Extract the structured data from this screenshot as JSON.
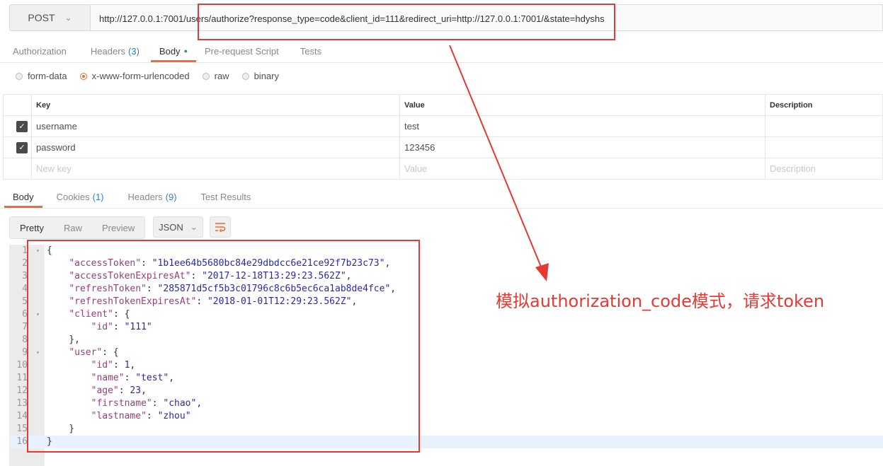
{
  "request": {
    "method": "POST",
    "url": "http://127.0.0.1:7001/users/authorize?response_type=code&client_id=111&redirect_uri=http://127.0.0.1:7001/&state=hdyshs"
  },
  "request_tabs": [
    {
      "label": "Authorization",
      "count": ""
    },
    {
      "label": "Headers",
      "count": "(3)"
    },
    {
      "label": "Body",
      "count": ""
    },
    {
      "label": "Pre-request Script",
      "count": ""
    },
    {
      "label": "Tests",
      "count": ""
    }
  ],
  "body_types": [
    "form-data",
    "x-www-form-urlencoded",
    "raw",
    "binary"
  ],
  "params_table": {
    "headers": [
      "Key",
      "Value",
      "Description"
    ],
    "rows": [
      {
        "key": "username",
        "value": "test",
        "description": ""
      },
      {
        "key": "password",
        "value": "123456",
        "description": ""
      }
    ],
    "placeholders": {
      "key": "New key",
      "value": "Value",
      "description": "Description"
    }
  },
  "response_tabs": [
    {
      "label": "Body",
      "count": ""
    },
    {
      "label": "Cookies",
      "count": "(1)"
    },
    {
      "label": "Headers",
      "count": "(9)"
    },
    {
      "label": "Test Results",
      "count": ""
    }
  ],
  "view_modes": [
    "Pretty",
    "Raw",
    "Preview"
  ],
  "format": "JSON",
  "response_lines": [
    [
      [
        "pun",
        "{"
      ]
    ],
    [
      [
        "pun",
        "    "
      ],
      [
        "key",
        "\"accessToken\""
      ],
      [
        "pun",
        ": "
      ],
      [
        "str",
        "\"1b1ee64b5680bc84e29dbdcc6e21ce92f7b23c73\""
      ],
      [
        "pun",
        ","
      ]
    ],
    [
      [
        "pun",
        "    "
      ],
      [
        "key",
        "\"accessTokenExpiresAt\""
      ],
      [
        "pun",
        ": "
      ],
      [
        "str",
        "\"2017-12-18T13:29:23.562Z\""
      ],
      [
        "pun",
        ","
      ]
    ],
    [
      [
        "pun",
        "    "
      ],
      [
        "key",
        "\"refreshToken\""
      ],
      [
        "pun",
        ": "
      ],
      [
        "str",
        "\"285871d5cf5b3c01796c8c6b5ec6ca1ab8de4fce\""
      ],
      [
        "pun",
        ","
      ]
    ],
    [
      [
        "pun",
        "    "
      ],
      [
        "key",
        "\"refreshTokenExpiresAt\""
      ],
      [
        "pun",
        ": "
      ],
      [
        "str",
        "\"2018-01-01T12:29:23.562Z\""
      ],
      [
        "pun",
        ","
      ]
    ],
    [
      [
        "pun",
        "    "
      ],
      [
        "key",
        "\"client\""
      ],
      [
        "pun",
        ": {"
      ]
    ],
    [
      [
        "pun",
        "        "
      ],
      [
        "key",
        "\"id\""
      ],
      [
        "pun",
        ": "
      ],
      [
        "str",
        "\"111\""
      ]
    ],
    [
      [
        "pun",
        "    },"
      ]
    ],
    [
      [
        "pun",
        "    "
      ],
      [
        "key",
        "\"user\""
      ],
      [
        "pun",
        ": {"
      ]
    ],
    [
      [
        "pun",
        "        "
      ],
      [
        "key",
        "\"id\""
      ],
      [
        "pun",
        ": "
      ],
      [
        "num",
        "1"
      ],
      [
        "pun",
        ","
      ]
    ],
    [
      [
        "pun",
        "        "
      ],
      [
        "key",
        "\"name\""
      ],
      [
        "pun",
        ": "
      ],
      [
        "str",
        "\"test\""
      ],
      [
        "pun",
        ","
      ]
    ],
    [
      [
        "pun",
        "        "
      ],
      [
        "key",
        "\"age\""
      ],
      [
        "pun",
        ": "
      ],
      [
        "num",
        "23"
      ],
      [
        "pun",
        ","
      ]
    ],
    [
      [
        "pun",
        "        "
      ],
      [
        "key",
        "\"firstname\""
      ],
      [
        "pun",
        ": "
      ],
      [
        "str",
        "\"chao\""
      ],
      [
        "pun",
        ","
      ]
    ],
    [
      [
        "pun",
        "        "
      ],
      [
        "key",
        "\"lastname\""
      ],
      [
        "pun",
        ": "
      ],
      [
        "str",
        "\"zhou\""
      ]
    ],
    [
      [
        "pun",
        "    }"
      ]
    ],
    [
      [
        "pun",
        "}"
      ]
    ]
  ],
  "annotation": "模拟authorization_code模式，请求token",
  "colors": {
    "accent": "#f26b3a",
    "annotation": "#e53935"
  }
}
